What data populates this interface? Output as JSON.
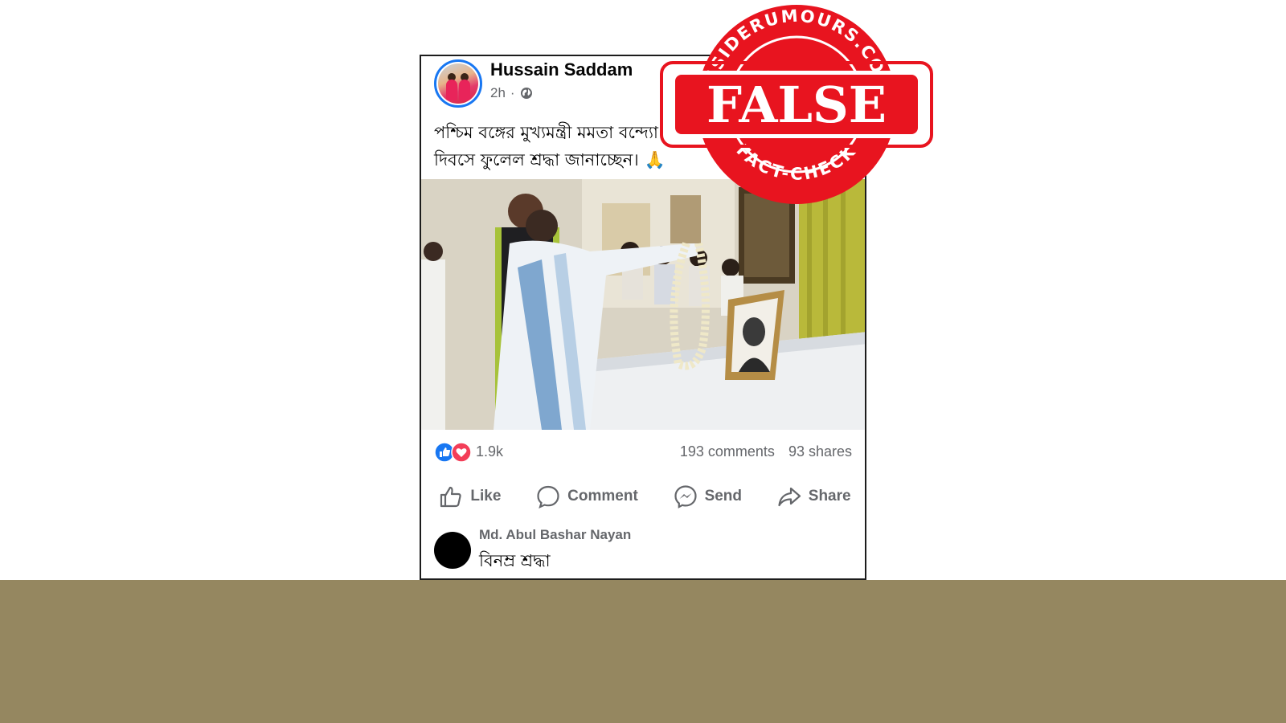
{
  "post": {
    "author_name": "Hussain Saddam",
    "time": "2h",
    "visibility_icon": "globe-icon",
    "text_line1": "পশ্চিম বঙ্গের মুখ্যমন্ত্রী মমতা বন্দ্যো",
    "text_line2": "দিবসে ফুলেল শ্রদ্ধা জানাচ্ছেন। 🙏",
    "reaction_icons": [
      "like-icon",
      "love-icon"
    ],
    "reaction_count": "1.9k",
    "comments_count": "193 comments",
    "shares_count": "93 shares"
  },
  "actions": {
    "like": "Like",
    "comment": "Comment",
    "send": "Send",
    "share": "Share"
  },
  "comment": {
    "author": "Md. Abul Bashar Nayan",
    "text": "বিনম্র শ্রদ্ধা"
  },
  "stamp": {
    "top_text": "INSIDERUMOURS.COM",
    "main_text": "FALSE",
    "bottom_text": "FACT-CHECK",
    "color": "#e8141f"
  },
  "colors": {
    "background_band": "#958760",
    "facebook_blue": "#1877f2",
    "muted_text": "#65676b"
  }
}
